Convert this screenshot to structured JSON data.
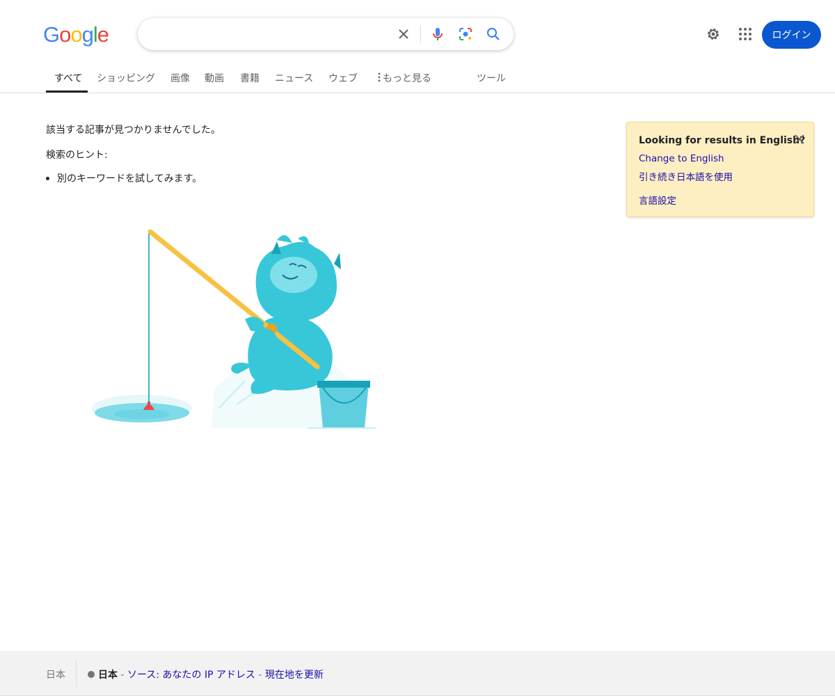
{
  "brand": {
    "logo_letters": [
      "G",
      "o",
      "o",
      "g",
      "l",
      "e"
    ],
    "logo_colors": [
      "#4285f4",
      "#ea4335",
      "#fbbc05",
      "#4285f4",
      "#34a853",
      "#ea4335"
    ]
  },
  "search": {
    "value": "",
    "icons": [
      "clear-icon",
      "microphone-icon",
      "lens-icon",
      "search-icon"
    ]
  },
  "header": {
    "icons": [
      "gear-icon",
      "apps-grid-icon"
    ],
    "login_label": "ログイン",
    "accent_color": "#0b57d0"
  },
  "tabs": [
    {
      "label": "すべて",
      "active": true
    },
    {
      "label": "ショッピング"
    },
    {
      "label": "画像"
    },
    {
      "label": "動画"
    },
    {
      "label": "書籍"
    },
    {
      "label": "ニュース"
    },
    {
      "label": "ウェブ"
    },
    {
      "label": "もっと見る",
      "icon": "more-vert-icon"
    },
    {
      "label": "ツール"
    }
  ],
  "results": {
    "message": "該当する記事が見つかりませんでした。",
    "hint_title": "検索のヒント:",
    "hints": [
      "別のキーワードを試してみます。"
    ],
    "illustration": "fishing-monster-illustration"
  },
  "language_card": {
    "title": "Looking for results in English?",
    "change_link": "Change to English",
    "keep_link": "引き続き日本語を使用",
    "settings_link": "言語設定",
    "background": "#feefc3",
    "close_icon": "close-icon"
  },
  "footer": {
    "country": "日本",
    "location": "日本",
    "separator1": " - ",
    "source_link": "ソース: あなたの IP アドレス",
    "separator2": " - ",
    "update_link": "現在地を更新"
  }
}
